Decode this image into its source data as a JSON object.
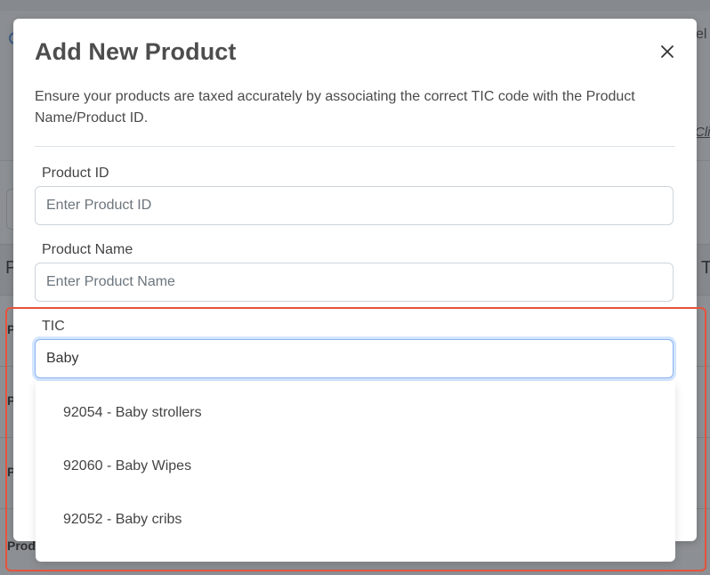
{
  "background": {
    "top_right_text": "el",
    "top_right_link": "Clic",
    "table_header_left": "P",
    "table_header_right": "T",
    "row_cells": [
      "P",
      "P",
      "P",
      "Prod"
    ]
  },
  "modal": {
    "title": "Add New Product",
    "description": "Ensure your products are taxed accurately by associating the correct TIC code with the Product Name/Product ID.",
    "fields": {
      "product_id": {
        "label": "Product ID",
        "placeholder": "Enter Product ID",
        "value": ""
      },
      "product_name": {
        "label": "Product Name",
        "placeholder": "Enter Product Name",
        "value": ""
      },
      "tic": {
        "label": "TIC",
        "placeholder": "",
        "value": "Baby"
      }
    },
    "dropdown_options": [
      "92054 - Baby strollers",
      "92060 - Baby Wipes",
      "92052 - Baby cribs"
    ]
  },
  "colors": {
    "highlight": "#e5533c",
    "focus_border": "#8bb4f0"
  }
}
